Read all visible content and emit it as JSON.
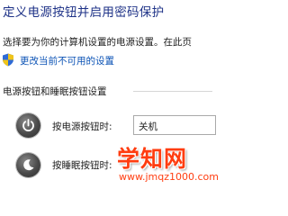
{
  "page": {
    "title": "定义电源按钮并启用密码保护",
    "intro": "选择要为你的计算机设置的电源设置。在此页"
  },
  "change_link": {
    "icon": "shield-icon",
    "label": "更改当前不可用的设置"
  },
  "section": {
    "header": "电源按钮和睡眠按钮设置",
    "rows": [
      {
        "icon": "power-icon",
        "label": "按电源按钮时:",
        "selected": "关机"
      },
      {
        "icon": "sleep-icon",
        "label": "按睡眠按钮时:"
      }
    ]
  },
  "watermark": {
    "logo": "学知网",
    "url": "www.jmqz1000.com"
  },
  "colors": {
    "title": "#1e3287",
    "link": "#0a52b5",
    "watermark": "#ff3d10"
  }
}
